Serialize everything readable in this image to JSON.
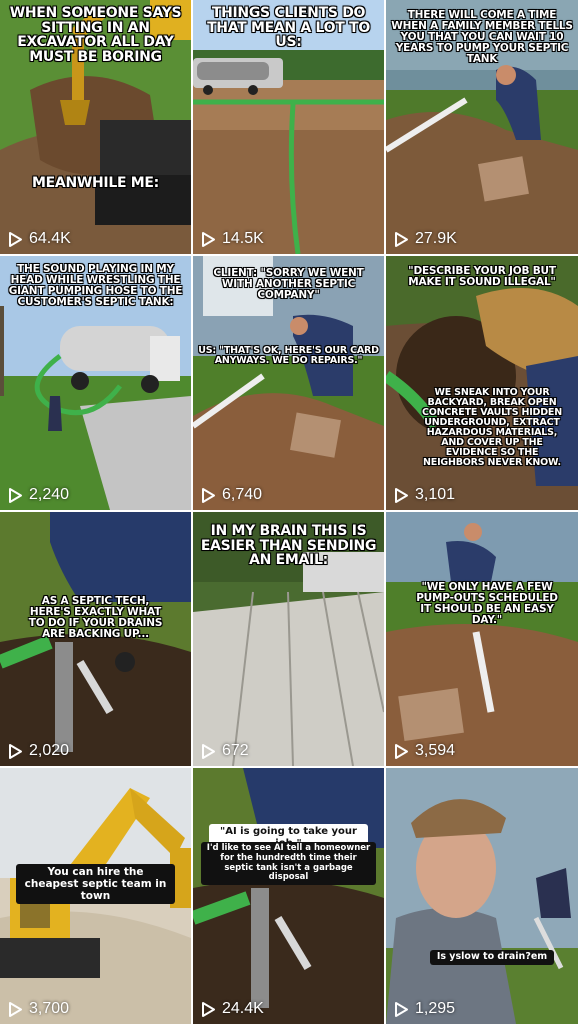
{
  "tiles": [
    {
      "caption": "WHEN SOMEONE SAYS SITTING IN AN EXCAVATOR ALL DAY MUST BE BORING",
      "caption2": "MEANWHILE ME:",
      "views": "64.4K"
    },
    {
      "caption": "THINGS CLIENTS DO THAT MEAN A LOT TO US:",
      "views": "14.5K"
    },
    {
      "caption": "THERE WILL COME A TIME WHEN A FAMILY MEMBER TELLS YOU THAT YOU CAN WAIT 10 YEARS TO PUMP YOUR SEPTIC TANK",
      "views": "27.9K"
    },
    {
      "caption": "THE SOUND PLAYING IN MY HEAD WHILE WRESTLING THE GIANT PUMPING HOSE TO THE CUSTOMER'S SEPTIC TANK:",
      "views": "2,240"
    },
    {
      "caption": "CLIENT: \"SORRY WE WENT WITH ANOTHER SEPTIC COMPANY\"",
      "caption2": "US: \"THAT'S OK, HERE'S OUR CARD ANYWAYS. WE DO REPAIRS.\"",
      "views": "6,740"
    },
    {
      "caption": "\"DESCRIBE YOUR JOB BUT MAKE IT SOUND ILLEGAL\"",
      "caption2": "WE SNEAK INTO YOUR BACKYARD, BREAK OPEN CONCRETE VAULTS HIDDEN UNDERGROUND, EXTRACT HAZARDOUS MATERIALS, AND COVER UP THE EVIDENCE SO THE NEIGHBORS NEVER KNOW.",
      "views": "3,101"
    },
    {
      "caption": "AS A SEPTIC TECH, HERE'S EXACTLY WHAT TO DO IF YOUR DRAINS ARE BACKING UP...",
      "views": "2,020"
    },
    {
      "caption": "IN MY BRAIN THIS IS EASIER THAN SENDING AN EMAIL:",
      "views": "672"
    },
    {
      "caption": "\"WE ONLY HAVE A FEW PUMP-OUTS SCHEDULED IT SHOULD BE AN EASY DAY.\"",
      "views": "3,594"
    },
    {
      "caption": "You can hire the cheapest septic team in town",
      "views": "3,700"
    },
    {
      "caption": "\"AI is going to take your job.\"",
      "caption2": "I'd like to see AI tell a homeowner for the hundredth time their septic tank isn't a garbage disposal",
      "views": "24.4K"
    },
    {
      "caption": "Is yslow to drain?em",
      "views": "1,295"
    }
  ],
  "icons": {
    "views": "play-icon"
  },
  "colors": {
    "grass": "#4f8a2e",
    "dirt": "#8a6a4a",
    "hose": "#3fb14a",
    "excavator": "#e0b020",
    "sky": "#a9c8e6"
  }
}
